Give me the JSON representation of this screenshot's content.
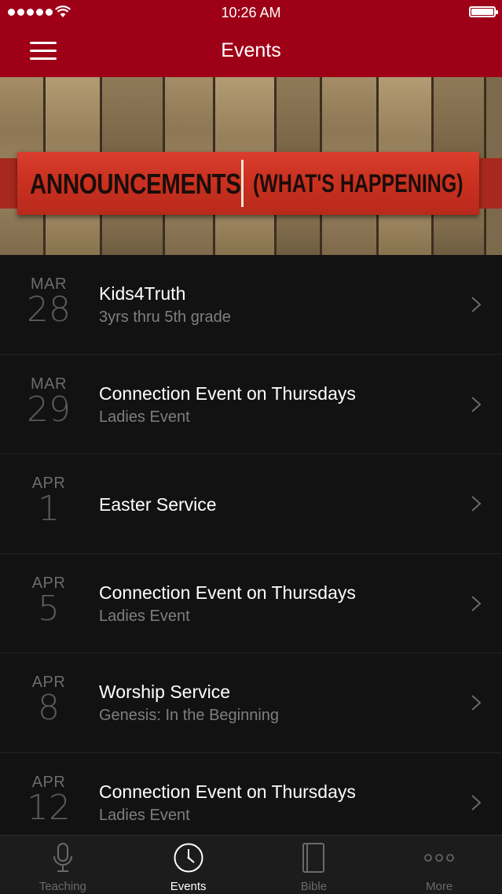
{
  "status_bar": {
    "time": "10:26 AM"
  },
  "nav": {
    "title": "Events"
  },
  "banner": {
    "left_text": "ANNOUNCEMENTS",
    "right_text": "(WHAT'S HAPPENING)"
  },
  "events": [
    {
      "month": "MAR",
      "day": "28",
      "title": "Kids4Truth",
      "subtitle": "3yrs thru 5th grade"
    },
    {
      "month": "MAR",
      "day": "29",
      "title": "Connection Event on Thursdays",
      "subtitle": "Ladies Event"
    },
    {
      "month": "APR",
      "day": "1",
      "title": "Easter Service",
      "subtitle": ""
    },
    {
      "month": "APR",
      "day": "5",
      "title": "Connection Event on Thursdays",
      "subtitle": "Ladies Event"
    },
    {
      "month": "APR",
      "day": "8",
      "title": "Worship Service",
      "subtitle": "Genesis: In the Beginning"
    },
    {
      "month": "APR",
      "day": "12",
      "title": "Connection Event on Thursdays",
      "subtitle": "Ladies Event"
    }
  ],
  "tabs": [
    {
      "label": "Teaching",
      "icon": "microphone-icon",
      "active": false
    },
    {
      "label": "Events",
      "icon": "clock-icon",
      "active": true
    },
    {
      "label": "Bible",
      "icon": "book-icon",
      "active": false
    },
    {
      "label": "More",
      "icon": "more-dots-icon",
      "active": false
    }
  ],
  "colors": {
    "nav_background": "#9e0018",
    "list_background": "#121212",
    "tab_bar_background": "#1c1c1c",
    "banner_ribbon": "#c9301f"
  }
}
